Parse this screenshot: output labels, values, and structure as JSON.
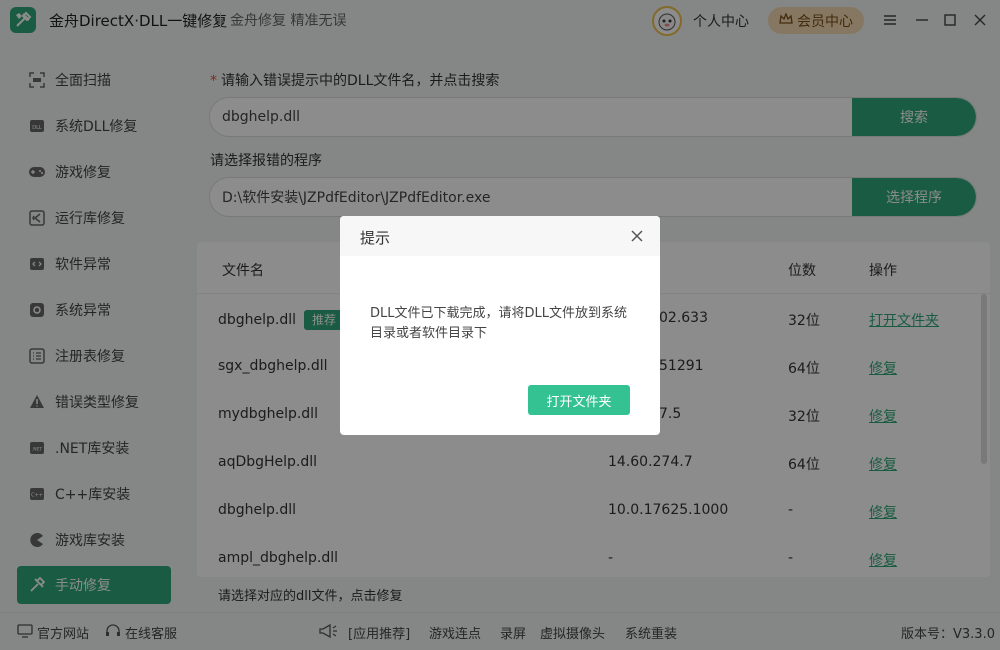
{
  "app": {
    "title": "金舟DirectX·DLL一键修复",
    "slogan": "金舟修复 精准无误",
    "personal_center": "个人中心",
    "vip_center": "会员中心"
  },
  "sidebar": {
    "items": [
      {
        "label": "全面扫描",
        "icon": "scan-icon"
      },
      {
        "label": "系统DLL修复",
        "icon": "dll-icon"
      },
      {
        "label": "游戏修复",
        "icon": "gamepad-icon"
      },
      {
        "label": "运行库修复",
        "icon": "vs-icon"
      },
      {
        "label": "软件异常",
        "icon": "code-icon"
      },
      {
        "label": "系统异常",
        "icon": "gear-icon"
      },
      {
        "label": "注册表修复",
        "icon": "list-icon"
      },
      {
        "label": "错误类型修复",
        "icon": "warning-icon"
      },
      {
        "label": ".NET库安装",
        "icon": "dotnet-icon"
      },
      {
        "label": "C++库安装",
        "icon": "cpp-icon"
      },
      {
        "label": "游戏库安装",
        "icon": "pacman-icon"
      },
      {
        "label": "手动修复",
        "icon": "tools-icon"
      }
    ]
  },
  "main": {
    "search_label": "请输入错误提示中的DLL文件名，并点击搜索",
    "search_value": "dbghelp.dll",
    "search_button": "搜索",
    "program_label": "请选择报错的程序",
    "program_value": "D:\\软件安装\\JZPdfEditor\\JZPdfEditor.exe",
    "program_button": "选择程序",
    "hint": "请选择对应的dll文件，点击修复"
  },
  "table": {
    "headers": {
      "name": "文件名",
      "bits": "位数",
      "action": "操作"
    },
    "rows": [
      {
        "name": "dbghelp.dll",
        "tag": "推荐",
        "version": "02.633",
        "bits": "32位",
        "action": "打开文件夹"
      },
      {
        "name": "sgx_dbghelp.dll",
        "tag": "",
        "version": "51291",
        "bits": "64位",
        "action": "修复"
      },
      {
        "name": "mydbghelp.dll",
        "tag": "",
        "version": "7.5",
        "bits": "32位",
        "action": "修复"
      },
      {
        "name": "aqDbgHelp.dll",
        "tag": "",
        "version": "14.60.274.7",
        "bits": "64位",
        "action": "修复"
      },
      {
        "name": "dbghelp.dll",
        "tag": "",
        "version": "10.0.17625.1000",
        "bits": "-",
        "action": "修复"
      },
      {
        "name": "ampl_dbghelp.dll",
        "tag": "",
        "version": "-",
        "bits": "-",
        "action": "修复"
      }
    ]
  },
  "footer": {
    "website": "官方网站",
    "support": "在线客服",
    "recommend": "[应用推荐]",
    "links": [
      "游戏连点",
      "录屏",
      "虚拟摄像头",
      "系统重装"
    ],
    "version": "版本号：V3.3.0"
  },
  "modal": {
    "title": "提示",
    "message": "DLL文件已下载完成，请将DLL文件放到系统目录或者软件目录下",
    "button": "打开文件夹"
  },
  "colors": {
    "accent": "#2ea87a",
    "vip_bg": "#f2d9b1",
    "modal_button": "#35c293"
  }
}
